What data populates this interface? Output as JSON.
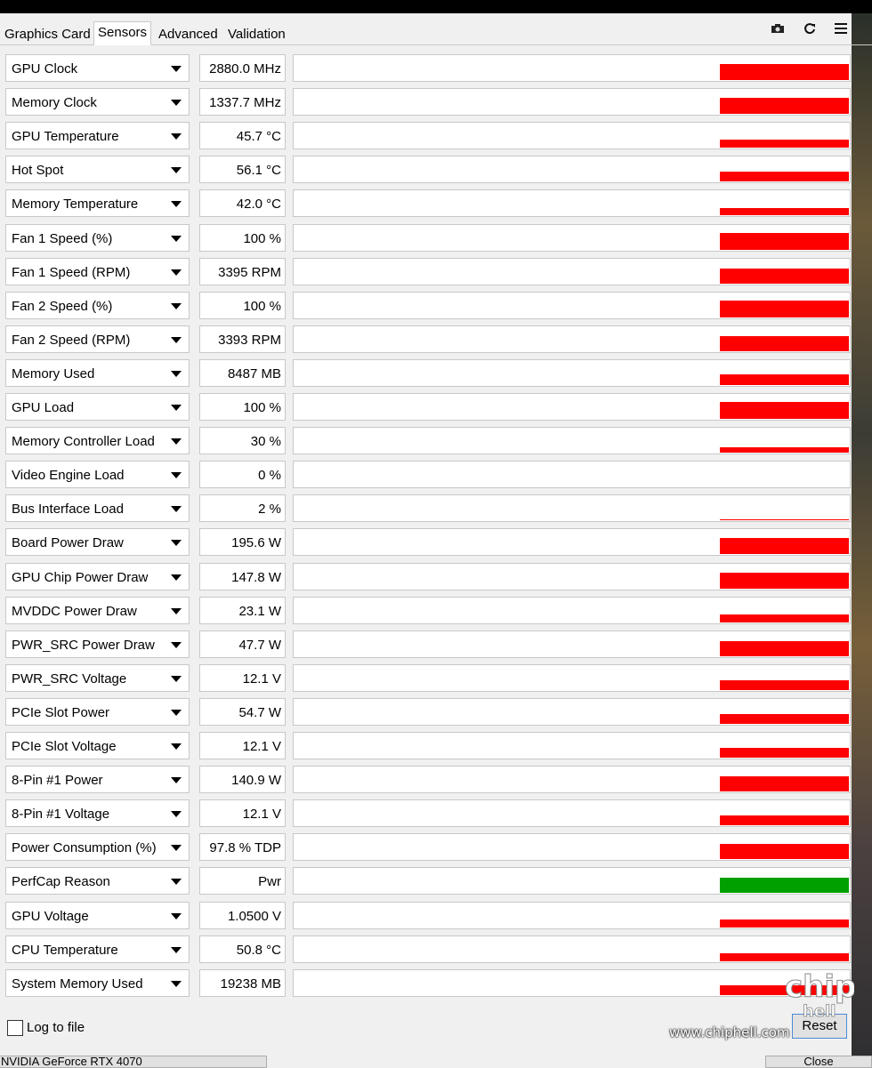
{
  "tabs": [
    {
      "label": "Graphics Card"
    },
    {
      "label": "Sensors"
    },
    {
      "label": "Advanced"
    },
    {
      "label": "Validation"
    }
  ],
  "active_tab": "Sensors",
  "toolbar": {
    "icons": [
      "camera-icon",
      "refresh-icon",
      "menu-icon"
    ]
  },
  "sensors": [
    {
      "name": "GPU Clock",
      "value": "2880.0 MHz",
      "level": 0.9,
      "color": "#ff0000"
    },
    {
      "name": "Memory Clock",
      "value": "1337.7 MHz",
      "level": 0.9,
      "color": "#ff0000"
    },
    {
      "name": "GPU Temperature",
      "value": "45.7 °C",
      "level": 0.45,
      "color": "#ff0000"
    },
    {
      "name": "Hot Spot",
      "value": "56.1 °C",
      "level": 0.55,
      "color": "#ff0000"
    },
    {
      "name": "Memory Temperature",
      "value": "42.0 °C",
      "level": 0.42,
      "color": "#ff0000"
    },
    {
      "name": "Fan 1 Speed (%)",
      "value": "100 %",
      "level": 0.95,
      "color": "#ff0000"
    },
    {
      "name": "Fan 1 Speed (RPM)",
      "value": "3395 RPM",
      "level": 0.85,
      "color": "#ff0000"
    },
    {
      "name": "Fan 2 Speed (%)",
      "value": "100 %",
      "level": 0.95,
      "color": "#ff0000"
    },
    {
      "name": "Fan 2 Speed (RPM)",
      "value": "3393 RPM",
      "level": 0.85,
      "color": "#ff0000"
    },
    {
      "name": "Memory Used",
      "value": "8487 MB",
      "level": 0.6,
      "color": "#ff0000"
    },
    {
      "name": "GPU Load",
      "value": "100 %",
      "level": 0.95,
      "color": "#ff0000"
    },
    {
      "name": "Memory Controller Load",
      "value": "30 %",
      "level": 0.3,
      "color": "#ff0000"
    },
    {
      "name": "Video Engine Load",
      "value": "0 %",
      "level": 0,
      "color": "#ff0000"
    },
    {
      "name": "Bus Interface Load",
      "value": "2 %",
      "level": 0.04,
      "color": "#ff0000"
    },
    {
      "name": "Board Power Draw",
      "value": "195.6 W",
      "level": 0.9,
      "color": "#ff0000"
    },
    {
      "name": "GPU Chip Power Draw",
      "value": "147.8 W",
      "level": 0.9,
      "color": "#ff0000"
    },
    {
      "name": "MVDDC Power Draw",
      "value": "23.1 W",
      "level": 0.45,
      "color": "#ff0000"
    },
    {
      "name": "PWR_SRC Power Draw",
      "value": "47.7 W",
      "level": 0.85,
      "color": "#ff0000"
    },
    {
      "name": "PWR_SRC Voltage",
      "value": "12.1 V",
      "level": 0.55,
      "color": "#ff0000"
    },
    {
      "name": "PCIe Slot Power",
      "value": "54.7 W",
      "level": 0.55,
      "color": "#ff0000"
    },
    {
      "name": "PCIe Slot Voltage",
      "value": "12.1 V",
      "level": 0.55,
      "color": "#ff0000"
    },
    {
      "name": "8-Pin #1 Power",
      "value": "140.9 W",
      "level": 0.85,
      "color": "#ff0000"
    },
    {
      "name": "8-Pin #1 Voltage",
      "value": "12.1 V",
      "level": 0.55,
      "color": "#ff0000"
    },
    {
      "name": "Power Consumption (%)",
      "value": "97.8 % TDP",
      "level": 0.85,
      "color": "#ff0000"
    },
    {
      "name": "PerfCap Reason",
      "value": "Pwr",
      "level": 0.85,
      "color": "#00a000"
    },
    {
      "name": "GPU Voltage",
      "value": "1.0500 V",
      "level": 0.45,
      "color": "#ff0000"
    },
    {
      "name": "CPU Temperature",
      "value": "50.8 °C",
      "level": 0.45,
      "color": "#ff0000"
    },
    {
      "name": "System Memory Used",
      "value": "19238 MB",
      "level": 0.55,
      "color": "#ff0000"
    }
  ],
  "footer": {
    "log_label": "Log to file",
    "reset_label": "Reset",
    "gpu_select": "NVIDIA GeForce RTX 4070",
    "close_label": "Close",
    "watermark": "www.chiphell.com",
    "watermark_logo": "chip hell"
  }
}
